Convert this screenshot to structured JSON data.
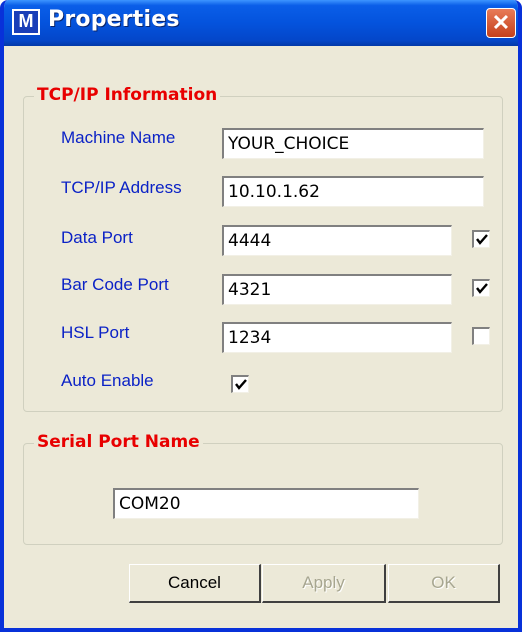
{
  "window": {
    "title": "Properties",
    "app_icon_glyph": "M",
    "close_glyph": "✕"
  },
  "tcpip": {
    "legend": "TCP/IP Information",
    "machine_name": {
      "label": "Machine Name",
      "value": "YOUR_CHOICE"
    },
    "tcpip_address": {
      "label": "TCP/IP Address",
      "value": "10.10.1.62"
    },
    "data_port": {
      "label": "Data Port",
      "value": "4444",
      "checked": true
    },
    "bar_code_port": {
      "label": "Bar Code Port",
      "value": "4321",
      "checked": true
    },
    "hsl_port": {
      "label": "HSL Port",
      "value": "1234",
      "checked": false
    },
    "auto_enable": {
      "label": "Auto Enable",
      "checked": true
    }
  },
  "serial": {
    "legend": "Serial Port Name",
    "value": "COM20"
  },
  "buttons": {
    "cancel": "Cancel",
    "apply": "Apply",
    "ok": "OK"
  },
  "colors": {
    "title_bar": "#0453DD",
    "legend_red": "#E80000",
    "label_blue": "#0B22C6",
    "face": "#ECE9D8"
  }
}
